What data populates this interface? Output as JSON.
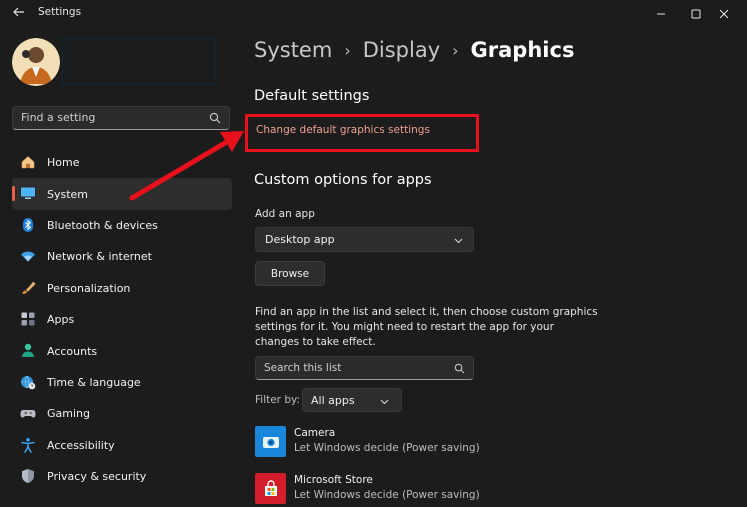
{
  "window": {
    "title": "Settings",
    "back_icon": "arrow-left-icon",
    "controls": [
      "minimize-icon",
      "maximize-icon",
      "close-icon"
    ]
  },
  "sidebar": {
    "search_placeholder": "Find a setting",
    "items": [
      {
        "label": "Home",
        "icon": "home-icon",
        "active": false
      },
      {
        "label": "System",
        "icon": "monitor-icon",
        "active": true
      },
      {
        "label": "Bluetooth & devices",
        "icon": "bluetooth-icon",
        "active": false
      },
      {
        "label": "Network & internet",
        "icon": "wifi-icon",
        "active": false
      },
      {
        "label": "Personalization",
        "icon": "brush-icon",
        "active": false
      },
      {
        "label": "Apps",
        "icon": "apps-icon",
        "active": false
      },
      {
        "label": "Accounts",
        "icon": "person-icon",
        "active": false
      },
      {
        "label": "Time & language",
        "icon": "globe-clock-icon",
        "active": false
      },
      {
        "label": "Gaming",
        "icon": "gamepad-icon",
        "active": false
      },
      {
        "label": "Accessibility",
        "icon": "accessibility-icon",
        "active": false
      },
      {
        "label": "Privacy & security",
        "icon": "shield-icon",
        "active": false
      }
    ]
  },
  "breadcrumb": {
    "items": [
      "System",
      "Display",
      "Graphics"
    ],
    "separator": "›"
  },
  "main": {
    "default_settings": {
      "heading": "Default settings",
      "link": "Change default graphics settings"
    },
    "custom_options": {
      "heading": "Custom options for apps",
      "add_app_label": "Add an app",
      "add_app_value": "Desktop app",
      "browse_label": "Browse",
      "description": "Find an app in the list and select it, then choose custom graphics settings for it. You might need to restart the app for your changes to take effect.",
      "search_placeholder": "Search this list",
      "filter_label": "Filter by:",
      "filter_value": "All apps"
    },
    "apps": [
      {
        "name": "Camera",
        "status": "Let Windows decide (Power saving)",
        "icon": "camera-icon",
        "color": "#1a86d9"
      },
      {
        "name": "Microsoft Store",
        "status": "Let Windows decide (Power saving)",
        "icon": "store-icon",
        "color": "#d31d2a"
      }
    ]
  },
  "colors": {
    "background": "#1c1c1c",
    "accent": "#e8604c",
    "annotation": "#e8101b"
  }
}
